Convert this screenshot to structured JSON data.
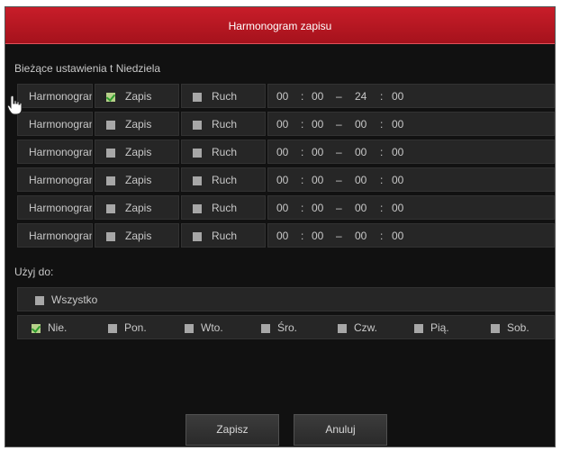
{
  "dialog": {
    "title": "Harmonogram zapisu"
  },
  "current_settings_label": "Bieżące ustawienia t Niedziela",
  "schedules": [
    {
      "label": "Harmonogram",
      "zapis_label": "Zapis",
      "zapis_checked": true,
      "ruch_label": "Ruch",
      "ruch_checked": false,
      "start_h": "00",
      "start_m": "00",
      "end_h": "24",
      "end_m": "00"
    },
    {
      "label": "Harmonogram",
      "zapis_label": "Zapis",
      "zapis_checked": false,
      "ruch_label": "Ruch",
      "ruch_checked": false,
      "start_h": "00",
      "start_m": "00",
      "end_h": "00",
      "end_m": "00"
    },
    {
      "label": "Harmonogram",
      "zapis_label": "Zapis",
      "zapis_checked": false,
      "ruch_label": "Ruch",
      "ruch_checked": false,
      "start_h": "00",
      "start_m": "00",
      "end_h": "00",
      "end_m": "00"
    },
    {
      "label": "Harmonogram",
      "zapis_label": "Zapis",
      "zapis_checked": false,
      "ruch_label": "Ruch",
      "ruch_checked": false,
      "start_h": "00",
      "start_m": "00",
      "end_h": "00",
      "end_m": "00"
    },
    {
      "label": "Harmonogram",
      "zapis_label": "Zapis",
      "zapis_checked": false,
      "ruch_label": "Ruch",
      "ruch_checked": false,
      "start_h": "00",
      "start_m": "00",
      "end_h": "00",
      "end_m": "00"
    },
    {
      "label": "Harmonogram",
      "zapis_label": "Zapis",
      "zapis_checked": false,
      "ruch_label": "Ruch",
      "ruch_checked": false,
      "start_h": "00",
      "start_m": "00",
      "end_h": "00",
      "end_m": "00"
    }
  ],
  "time_sep": ":",
  "range_sep": "–",
  "apply_to_label": "Użyj do:",
  "all": {
    "label": "Wszystko",
    "checked": false
  },
  "days": [
    {
      "label": "Nie.",
      "checked": true
    },
    {
      "label": "Pon.",
      "checked": false
    },
    {
      "label": "Wto.",
      "checked": false
    },
    {
      "label": "Śro.",
      "checked": false
    },
    {
      "label": "Czw.",
      "checked": false
    },
    {
      "label": "Pią.",
      "checked": false
    },
    {
      "label": "Sob.",
      "checked": false
    }
  ],
  "buttons": {
    "save": "Zapisz",
    "cancel": "Anuluj"
  },
  "icons": {
    "cursor": "hand-pointer-icon",
    "checkbox": "checkbox-icon"
  },
  "colors": {
    "title_bar": "#b5141f",
    "background": "#111111",
    "row": "#262626",
    "check_on": "#b7d18a",
    "check_off": "#a7a7a7"
  }
}
